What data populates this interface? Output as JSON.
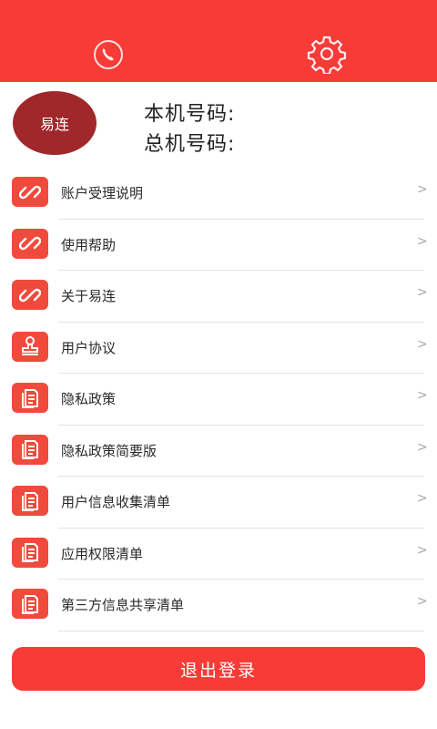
{
  "header": {
    "phone_icon": "phone-icon",
    "settings_icon": "gear-icon",
    "bg_color": "#f73b37"
  },
  "profile": {
    "avatar_text": "易连",
    "local_number_label": "本机号码:",
    "main_number_label": "总机号码:"
  },
  "menu": {
    "items": [
      {
        "label": "账户受理说明",
        "icon": "link-icon"
      },
      {
        "label": "使用帮助",
        "icon": "link-icon"
      },
      {
        "label": "关于易连",
        "icon": "link-icon"
      },
      {
        "label": "用户协议",
        "icon": "stamp-icon"
      },
      {
        "label": "隐私政策",
        "icon": "document-icon"
      },
      {
        "label": "隐私政策简要版",
        "icon": "document-icon"
      },
      {
        "label": "用户信息收集清单",
        "icon": "document-icon"
      },
      {
        "label": "应用权限清单",
        "icon": "document-icon"
      },
      {
        "label": "第三方信息共享清单",
        "icon": "document-icon"
      }
    ],
    "chevron": ">"
  },
  "logout_label": "退出登录"
}
